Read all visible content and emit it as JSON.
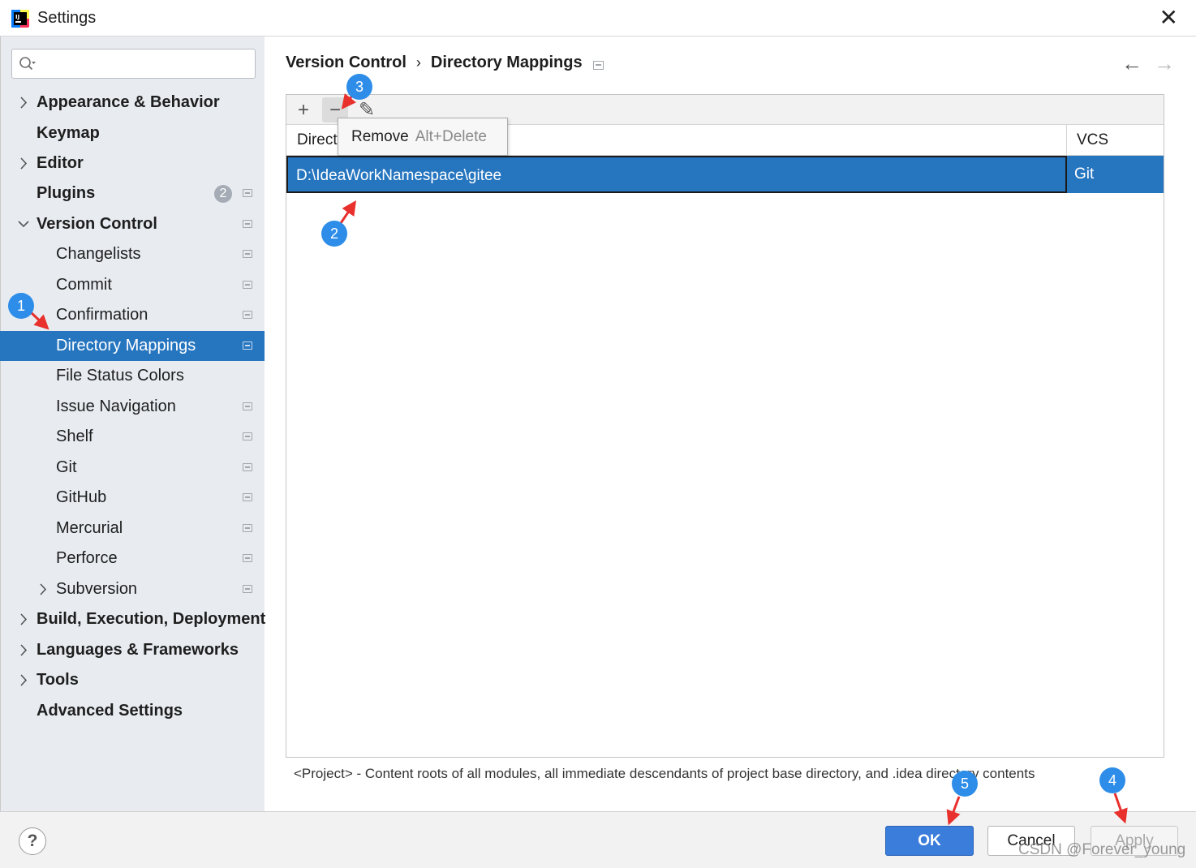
{
  "window": {
    "title": "Settings",
    "close_glyph": "✕"
  },
  "search": {
    "placeholder": "",
    "value": ""
  },
  "sidebar": {
    "items": [
      {
        "label": "Appearance & Behavior"
      },
      {
        "label": "Keymap"
      },
      {
        "label": "Editor"
      },
      {
        "label": "Plugins",
        "badge": "2"
      },
      {
        "label": "Version Control"
      },
      {
        "label": "Changelists"
      },
      {
        "label": "Commit"
      },
      {
        "label": "Confirmation"
      },
      {
        "label": "Directory Mappings"
      },
      {
        "label": "File Status Colors"
      },
      {
        "label": "Issue Navigation"
      },
      {
        "label": "Shelf"
      },
      {
        "label": "Git"
      },
      {
        "label": "GitHub"
      },
      {
        "label": "Mercurial"
      },
      {
        "label": "Perforce"
      },
      {
        "label": "Subversion"
      },
      {
        "label": "Build, Execution, Deployment"
      },
      {
        "label": "Languages & Frameworks"
      },
      {
        "label": "Tools"
      },
      {
        "label": "Advanced Settings"
      }
    ],
    "selected": "Directory Mappings"
  },
  "breadcrumb": {
    "parent": "Version Control",
    "separator": "›",
    "current": "Directory Mappings"
  },
  "nav": {
    "back": "←",
    "forward": "→"
  },
  "toolbar": {
    "add": "+",
    "remove": "−",
    "edit": "✎"
  },
  "tooltip": {
    "label": "Remove",
    "shortcut": "Alt+Delete"
  },
  "table": {
    "columns": [
      "Direct",
      "VCS"
    ],
    "rows": [
      {
        "directory": "D:\\IdeaWorkNamespace\\gitee",
        "vcs": "Git"
      }
    ]
  },
  "note": "<Project> - Content roots of all modules, all immediate descendants of project base directory, and .idea directory contents",
  "buttons": {
    "help": "?",
    "ok": "OK",
    "cancel": "Cancel",
    "apply": "Apply"
  },
  "annotations": [
    "1",
    "2",
    "3",
    "4",
    "5"
  ],
  "watermark": "CSDN @Forever_young",
  "colors": {
    "selection": "#2675bf",
    "ok_button": "#3b7ddb",
    "marker": "#2d8de8",
    "arrow": "#e8302d",
    "sidebar_bg": "#e8ecf1"
  },
  "icons": [
    "intellij-app-icon",
    "search-icon",
    "chevron-right-icon",
    "chevron-down-icon",
    "page-icon",
    "back-arrow-icon",
    "forward-arrow-icon",
    "plus-icon",
    "minus-icon",
    "pencil-icon",
    "help-icon"
  ]
}
